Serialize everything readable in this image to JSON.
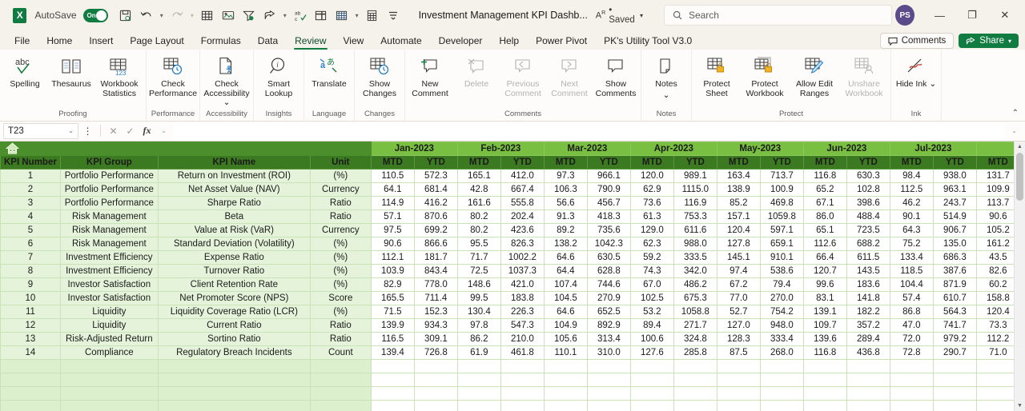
{
  "titlebar": {
    "app_logo": "excel-logo",
    "logo_letter": "X",
    "autosave_label": "AutoSave",
    "autosave_state": "On",
    "document_title": "Investment Management KPI Dashb...",
    "save_state": "• Saved",
    "search_placeholder": "Search",
    "avatar_initials": "PS",
    "quick_access": [
      {
        "name": "save-icon"
      },
      {
        "name": "undo-icon"
      },
      {
        "name": "redo-icon"
      },
      {
        "name": "table-icon"
      },
      {
        "name": "picture-icon"
      },
      {
        "name": "filter-icon"
      },
      {
        "name": "share-arrow-icon"
      },
      {
        "name": "spelling-icon"
      },
      {
        "name": "freeze-panes-icon"
      },
      {
        "name": "borders-icon"
      },
      {
        "name": "calculation-icon"
      },
      {
        "name": "customize-quick-access-icon"
      }
    ],
    "window_buttons": [
      "minimize",
      "restore",
      "close"
    ]
  },
  "tabs": [
    {
      "label": "File",
      "active": false
    },
    {
      "label": "Home",
      "active": false
    },
    {
      "label": "Insert",
      "active": false
    },
    {
      "label": "Page Layout",
      "active": false
    },
    {
      "label": "Formulas",
      "active": false
    },
    {
      "label": "Data",
      "active": false
    },
    {
      "label": "Review",
      "active": true
    },
    {
      "label": "View",
      "active": false
    },
    {
      "label": "Automate",
      "active": false
    },
    {
      "label": "Developer",
      "active": false
    },
    {
      "label": "Help",
      "active": false
    },
    {
      "label": "Power Pivot",
      "active": false
    },
    {
      "label": "PK's Utility Tool V3.0",
      "active": false
    }
  ],
  "tabbar_right": {
    "comments_label": "Comments",
    "share_label": "Share",
    "share_color": "#107c41"
  },
  "ribbon": {
    "groups": [
      {
        "label": "Proofing",
        "items": [
          {
            "label": "Spelling",
            "icon": "spelling-abc-check-icon",
            "disabled": false
          },
          {
            "label": "Thesaurus",
            "icon": "thesaurus-book-icon",
            "disabled": false
          },
          {
            "label": "Workbook Statistics",
            "icon": "workbook-statistics-icon",
            "disabled": false
          }
        ]
      },
      {
        "label": "Performance",
        "items": [
          {
            "label": "Check Performance",
            "icon": "check-performance-clock-icon",
            "disabled": false
          }
        ]
      },
      {
        "label": "Accessibility",
        "items": [
          {
            "label": "Check Accessibility",
            "icon": "check-accessibility-icon",
            "disabled": false,
            "caret": true
          }
        ]
      },
      {
        "label": "Insights",
        "items": [
          {
            "label": "Smart Lookup",
            "icon": "smart-lookup-magnifier-icon",
            "disabled": false
          }
        ]
      },
      {
        "label": "Language",
        "items": [
          {
            "label": "Translate",
            "icon": "translate-icon",
            "disabled": false
          }
        ]
      },
      {
        "label": "Changes",
        "items": [
          {
            "label": "Show Changes",
            "icon": "show-changes-clock-icon",
            "disabled": false
          }
        ]
      },
      {
        "label": "Comments",
        "items": [
          {
            "label": "New Comment",
            "icon": "new-comment-icon",
            "disabled": false
          },
          {
            "label": "Delete",
            "icon": "delete-comment-icon",
            "disabled": true
          },
          {
            "label": "Previous Comment",
            "icon": "previous-comment-icon",
            "disabled": true
          },
          {
            "label": "Next Comment",
            "icon": "next-comment-icon",
            "disabled": true
          },
          {
            "label": "Show Comments",
            "icon": "show-comments-icon",
            "disabled": false
          }
        ]
      },
      {
        "label": "Notes",
        "items": [
          {
            "label": "Notes",
            "icon": "notes-icon",
            "disabled": false,
            "caret": true
          }
        ]
      },
      {
        "label": "Protect",
        "items": [
          {
            "label": "Protect Sheet",
            "icon": "protect-sheet-lock-icon",
            "disabled": false
          },
          {
            "label": "Protect Workbook",
            "icon": "protect-workbook-lock-icon",
            "disabled": false
          },
          {
            "label": "Allow Edit Ranges",
            "icon": "allow-edit-ranges-pencil-icon",
            "disabled": false
          },
          {
            "label": "Unshare Workbook",
            "icon": "unshare-workbook-icon",
            "disabled": true
          }
        ]
      },
      {
        "label": "Ink",
        "items": [
          {
            "label": "Hide Ink",
            "icon": "hide-ink-icon",
            "disabled": false,
            "caret": true
          }
        ]
      }
    ]
  },
  "formula_bar": {
    "name_box_value": "T23",
    "formula_value": "",
    "cancel_icon": "cancel-icon",
    "enter_icon": "enter-check-icon",
    "fx_label": "fx"
  },
  "sheet": {
    "home_icon": "home-icon",
    "header_color": "#4a8f2c",
    "month_header_color": "#79bf42",
    "column_header_color": "#3c7a21",
    "left_headers": [
      "KPI Number",
      "KPI Group",
      "KPI Name",
      "Unit"
    ],
    "months": [
      "Jan-2023",
      "Feb-2023",
      "Mar-2023",
      "Apr-2023",
      "May-2023",
      "Jun-2023",
      "Jul-2023"
    ],
    "sub_headers": [
      "MTD",
      "YTD"
    ],
    "partial_month_sub_header": "MTD",
    "rows": [
      {
        "num": "1",
        "group": "Portfolio Performance",
        "name": "Return on Investment (ROI)",
        "unit": "(%)",
        "values": [
          "110.5",
          "572.3",
          "165.1",
          "412.0",
          "97.3",
          "966.1",
          "120.0",
          "989.1",
          "163.4",
          "713.7",
          "116.8",
          "630.3",
          "98.4",
          "938.0",
          "131.7"
        ]
      },
      {
        "num": "2",
        "group": "Portfolio Performance",
        "name": "Net Asset Value (NAV)",
        "unit": "Currency",
        "values": [
          "64.1",
          "681.4",
          "42.8",
          "667.4",
          "106.3",
          "790.9",
          "62.9",
          "1115.0",
          "138.9",
          "100.9",
          "65.2",
          "102.8",
          "112.5",
          "963.1",
          "109.9"
        ]
      },
      {
        "num": "3",
        "group": "Portfolio Performance",
        "name": "Sharpe Ratio",
        "unit": "Ratio",
        "values": [
          "114.9",
          "416.2",
          "161.6",
          "555.8",
          "56.6",
          "456.7",
          "73.6",
          "116.9",
          "85.2",
          "469.8",
          "67.1",
          "398.6",
          "46.2",
          "243.7",
          "113.7"
        ]
      },
      {
        "num": "4",
        "group": "Risk Management",
        "name": "Beta",
        "unit": "Ratio",
        "values": [
          "57.1",
          "870.6",
          "80.2",
          "202.4",
          "91.3",
          "418.3",
          "61.3",
          "753.3",
          "157.1",
          "1059.8",
          "86.0",
          "488.4",
          "90.1",
          "514.9",
          "90.6"
        ]
      },
      {
        "num": "5",
        "group": "Risk Management",
        "name": "Value at Risk (VaR)",
        "unit": "Currency",
        "values": [
          "97.5",
          "699.2",
          "80.2",
          "423.6",
          "89.2",
          "735.6",
          "129.0",
          "611.6",
          "120.4",
          "597.1",
          "65.1",
          "723.5",
          "64.3",
          "906.7",
          "105.2"
        ]
      },
      {
        "num": "6",
        "group": "Risk Management",
        "name": "Standard Deviation (Volatility)",
        "unit": "(%)",
        "values": [
          "90.6",
          "866.6",
          "95.5",
          "826.3",
          "138.2",
          "1042.3",
          "62.3",
          "988.0",
          "127.8",
          "659.1",
          "112.6",
          "688.2",
          "75.2",
          "135.0",
          "161.2"
        ]
      },
      {
        "num": "7",
        "group": "Investment Efficiency",
        "name": "Expense Ratio",
        "unit": "(%)",
        "values": [
          "112.1",
          "181.7",
          "71.7",
          "1002.2",
          "64.6",
          "630.5",
          "59.2",
          "333.5",
          "145.1",
          "910.1",
          "66.4",
          "611.5",
          "133.4",
          "686.3",
          "43.5"
        ]
      },
      {
        "num": "8",
        "group": "Investment Efficiency",
        "name": "Turnover Ratio",
        "unit": "(%)",
        "values": [
          "103.9",
          "843.4",
          "72.5",
          "1037.3",
          "64.4",
          "628.8",
          "74.3",
          "342.0",
          "97.4",
          "538.6",
          "120.7",
          "143.5",
          "118.5",
          "387.6",
          "82.6"
        ]
      },
      {
        "num": "9",
        "group": "Investor Satisfaction",
        "name": "Client Retention Rate",
        "unit": "(%)",
        "values": [
          "82.9",
          "778.0",
          "148.6",
          "421.0",
          "107.4",
          "744.6",
          "67.0",
          "486.2",
          "67.2",
          "79.4",
          "99.6",
          "183.6",
          "104.4",
          "871.9",
          "60.2"
        ]
      },
      {
        "num": "10",
        "group": "Investor Satisfaction",
        "name": "Net Promoter Score (NPS)",
        "unit": "Score",
        "values": [
          "165.5",
          "711.4",
          "99.5",
          "183.8",
          "104.5",
          "270.9",
          "102.5",
          "675.3",
          "77.0",
          "270.0",
          "83.1",
          "141.8",
          "57.4",
          "610.7",
          "158.8"
        ]
      },
      {
        "num": "11",
        "group": "Liquidity",
        "name": "Liquidity Coverage Ratio (LCR)",
        "unit": "(%)",
        "values": [
          "71.5",
          "152.3",
          "130.4",
          "226.3",
          "64.6",
          "652.5",
          "53.2",
          "1058.8",
          "52.7",
          "754.2",
          "139.1",
          "182.2",
          "86.8",
          "564.3",
          "120.4"
        ]
      },
      {
        "num": "12",
        "group": "Liquidity",
        "name": "Current Ratio",
        "unit": "Ratio",
        "values": [
          "139.9",
          "934.3",
          "97.8",
          "547.3",
          "104.9",
          "892.9",
          "89.4",
          "271.7",
          "127.0",
          "948.0",
          "109.7",
          "357.2",
          "47.0",
          "741.7",
          "73.3"
        ]
      },
      {
        "num": "13",
        "group": "Risk-Adjusted Return",
        "name": "Sortino Ratio",
        "unit": "Ratio",
        "values": [
          "116.5",
          "309.1",
          "86.2",
          "210.0",
          "105.6",
          "313.4",
          "100.6",
          "324.8",
          "128.3",
          "333.4",
          "139.6",
          "289.4",
          "72.0",
          "979.2",
          "112.2"
        ]
      },
      {
        "num": "14",
        "group": "Compliance",
        "name": "Regulatory Breach Incidents",
        "unit": "Count",
        "values": [
          "139.4",
          "726.8",
          "61.9",
          "461.8",
          "110.1",
          "310.0",
          "127.6",
          "285.8",
          "87.5",
          "268.0",
          "116.8",
          "436.8",
          "72.8",
          "290.7",
          "71.0"
        ]
      }
    ],
    "blank_rows": 4
  }
}
